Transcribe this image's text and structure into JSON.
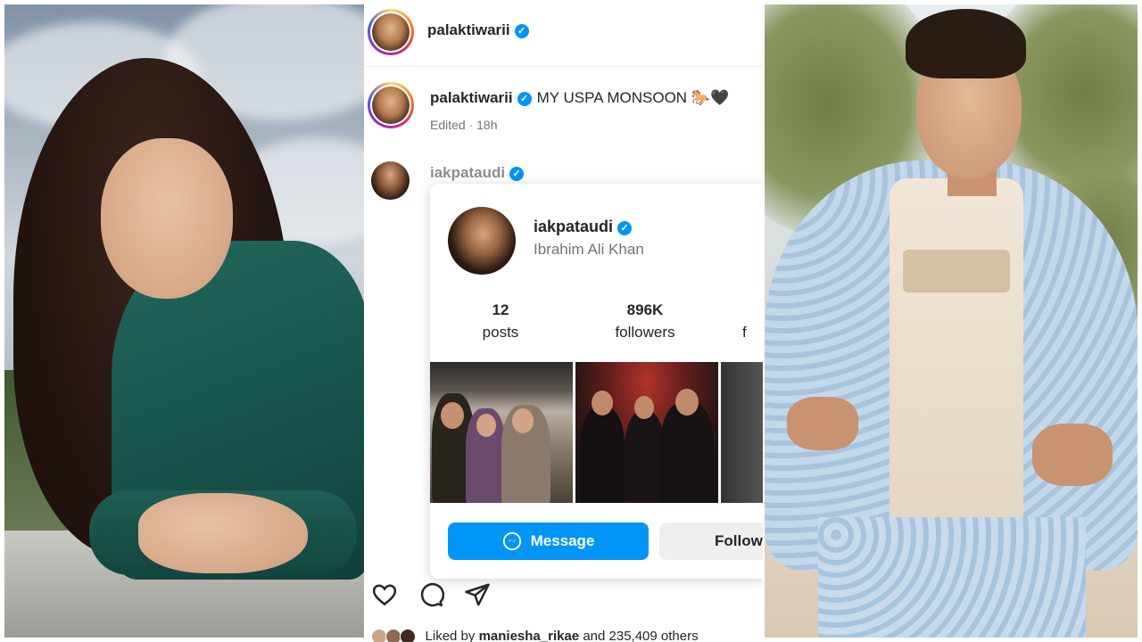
{
  "post": {
    "author": "palaktiwarii",
    "caption_text": "MY USPA MONSOON 🐎🖤",
    "meta": "Edited · 18h",
    "verified_mark": "✓"
  },
  "comment": {
    "username": "iakpataudi"
  },
  "hover_card": {
    "username": "iakpataudi",
    "full_name": "Ibrahim Ali Khan",
    "stats": [
      {
        "value": "12",
        "label": "posts"
      },
      {
        "value": "896K",
        "label": "followers"
      },
      {
        "value": "",
        "label": "f"
      }
    ],
    "message_button": "Message",
    "follow_button": "Follow"
  },
  "actions": {
    "icons": [
      "heart-icon",
      "comment-icon",
      "share-icon"
    ]
  },
  "likes": {
    "prefix": "Liked by",
    "user": "maniesha_rikae",
    "suffix": "and 235,409 others"
  },
  "colors": {
    "accent": "#0095f6",
    "text": "#262626",
    "muted": "#737373"
  }
}
